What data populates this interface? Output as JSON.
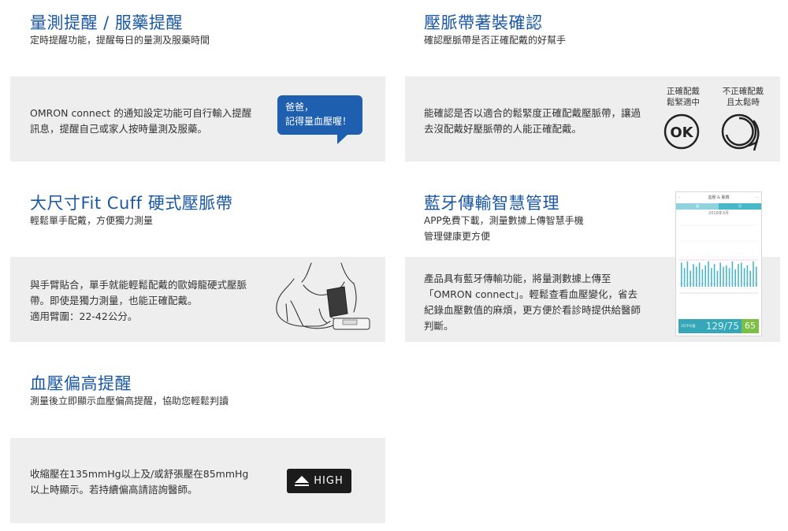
{
  "features": [
    {
      "title": "量測提醒 / 服藥提醒",
      "subtitle": "定時提醒功能，提醒每日的量測及服藥時間",
      "body": [
        "OMRON connect 的通知設定功能可自行輸入提醒",
        "訊息，提醒自己或家人按時量測及服藥。"
      ],
      "bubble": [
        "爸爸，",
        "記得量血壓喔！"
      ]
    },
    {
      "title": "壓脈帶著裝確認",
      "subtitle": "確認壓脈帶是否正確配戴的好幫手",
      "body": [
        "能確認是否以適合的鬆緊度正確配戴壓脈帶，讓過",
        "去沒配戴好壓脈帶的人能正確配戴。"
      ],
      "ok_label": [
        "正確配戴",
        "鬆緊適中"
      ],
      "bad_label": [
        "不正確配戴",
        "且太鬆時"
      ],
      "ok_icon_text": "OK"
    },
    {
      "title": "大尺寸Fit Cuff 硬式壓脈帶",
      "subtitle": "輕鬆單手配戴，方便獨力測量",
      "body": [
        "與手臂貼合，單手就能輕鬆配戴的歐姆龍硬式壓脈",
        "帶。即使是獨力測量，也能正確配戴。",
        "適用臂圍：22-42公分。"
      ]
    },
    {
      "title": "藍牙傳輸智慧管理",
      "subtitle": [
        "APP免費下載，測量數據上傳智慧手機",
        "管理健康更方便"
      ],
      "body": [
        "產品具有藍牙傳輸功能，將量測數據上傳至",
        "「OMRON connect」。輕鬆查看血壓變化，省去",
        "紀錄血壓數值的麻煩，更方便於看診時提供給醫師",
        "判斷。"
      ],
      "phone": {
        "header": "血壓 & 脈搏",
        "tabs": [
          "週",
          "月"
        ],
        "month": "2016年3月",
        "footer_label": "3月平均值",
        "bp": "129/75",
        "pulse": "65"
      }
    },
    {
      "title": "血壓偏高提醒",
      "subtitle": "測量後立即顯示血壓偏高提醒，協助您輕鬆判讀",
      "body": [
        "收縮壓在135mmHg以上及/或舒張壓在85mmHg",
        "以上時顯示。若持續偏高請諮詢醫師。"
      ],
      "badge": "HIGH"
    }
  ],
  "colors": {
    "title": "#1a57a6",
    "panel": "#eeeeee",
    "bubble": "#1f5fb0",
    "accent": "#48b8c8"
  }
}
